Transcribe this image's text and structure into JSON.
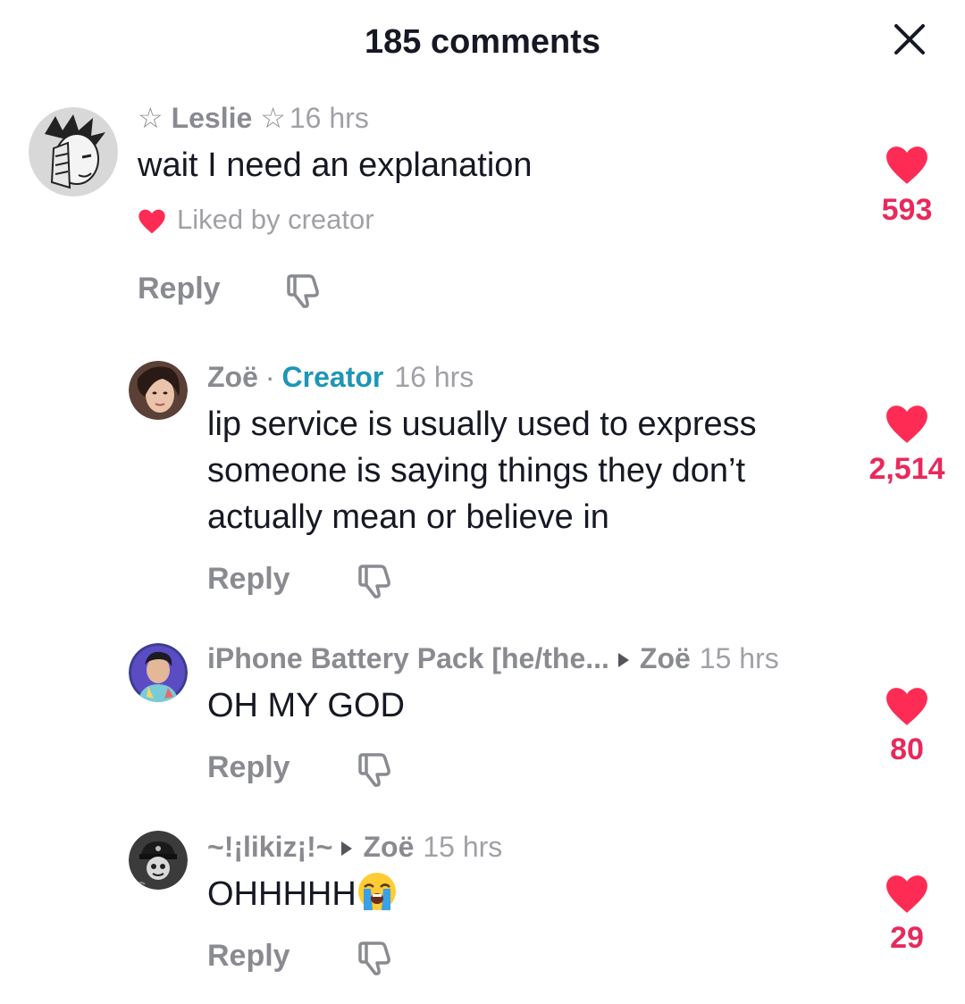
{
  "header": {
    "title": "185 comments"
  },
  "comments": [
    {
      "username": "☆ Leslie ☆",
      "time": "16 hrs",
      "text": "wait I need an explanation",
      "liked_by_creator": "Liked by creator",
      "likes": "593",
      "reply_label": "Reply"
    },
    {
      "username": "Zoë",
      "separator": "·",
      "creator_badge": "Creator",
      "time": "16 hrs",
      "text_lines": [
        "lip service is usually used to express",
        "someone is saying things they don’t",
        "actually mean or believe in"
      ],
      "likes": "2,514",
      "reply_label": "Reply"
    },
    {
      "username": "iPhone Battery Pack [he/the...",
      "reply_to": "Zoë",
      "time": "15 hrs",
      "text": "OH MY GOD",
      "likes": "80",
      "reply_label": "Reply"
    },
    {
      "username": "~!¡likiz¡!~",
      "reply_to": "Zoë",
      "time": "15 hrs",
      "text": "OHHHHH",
      "emoji": "loudly-crying-face",
      "likes": "29",
      "reply_label": "Reply"
    }
  ],
  "colors": {
    "heart": "#fe2c55",
    "like_count": "#e8295c",
    "creator_badge": "#1d96b8",
    "secondary_text": "#8a8b91",
    "primary_text": "#161823"
  }
}
